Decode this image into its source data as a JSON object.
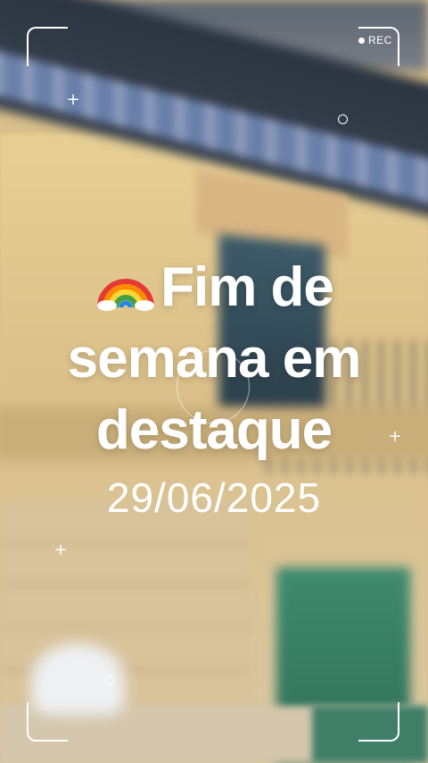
{
  "overlay": {
    "rec_label": "REC"
  },
  "headline": {
    "icon": "rainbow-icon",
    "line1": "Fim de",
    "line2": "semana em",
    "line3": "destaque"
  },
  "date": "29/06/2025",
  "colors": {
    "text": "#ffffff",
    "wall": "#e7cf93",
    "roof": "#2b3441",
    "door": "#3f8a6f"
  }
}
